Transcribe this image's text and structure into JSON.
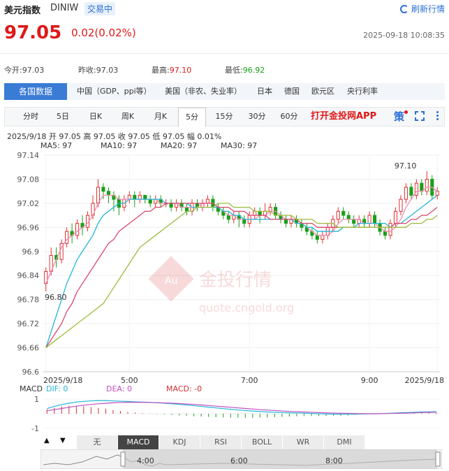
{
  "header": {
    "name": "美元指数",
    "code": "DINIW",
    "market_tag": "交易中",
    "refresh_label": "刷新行情",
    "price": "97.05",
    "change": "0.02(0.02%)",
    "datetime": "2025-09-18 10:08:35"
  },
  "stats": [
    {
      "label": "今开:",
      "value": "97.03",
      "tone": "normal"
    },
    {
      "label": "昨收:",
      "value": "97.03",
      "tone": "normal"
    },
    {
      "label": "最高:",
      "value": "97.10",
      "tone": "red"
    },
    {
      "label": "最低:",
      "value": "96.92",
      "tone": "green"
    }
  ],
  "regions": {
    "active": "各国数据",
    "items": [
      "中国（GDP、ppi等）",
      "美国（非农、失业率）",
      "日本",
      "德国",
      "欧元区",
      "央行利率"
    ]
  },
  "periods": {
    "items": [
      "分时",
      "5日",
      "日K",
      "周K",
      "月K",
      "5分",
      "15分",
      "30分",
      "60分"
    ],
    "active_index": 5,
    "promo": "打开金投网APP",
    "strategy_label": "策"
  },
  "ohlc_line": "2025/9/18  开 97.05  高 97.05  收 97.05  低 97.05  幅 0.01%",
  "ma_legend": [
    {
      "label": "MA5: 97",
      "color": "#f08cb4"
    },
    {
      "label": "MA10: 97",
      "color": "#22b5d8"
    },
    {
      "label": "MA20: 97",
      "color": "#d9466c"
    },
    {
      "label": "MA30: 97",
      "color": "#9cbc3c"
    }
  ],
  "watermark": {
    "brand": "金投行情",
    "site": "quote.cngold.org",
    "badge": "Au"
  },
  "chart_data": {
    "type": "candlestick",
    "title": "",
    "y_ticks": [
      "97.14",
      "97.08",
      "97.02",
      "96.96",
      "96.9",
      "96.84",
      "96.78",
      "96.72",
      "96.66",
      "96.6"
    ],
    "ylim": [
      96.6,
      97.14
    ],
    "x_labels": [
      "2025/9/18",
      "5:00",
      "7:00",
      "9:00",
      "2025/9/18"
    ],
    "high_label": "97.10",
    "low_label": "96.80",
    "candles": [
      [
        96.82,
        96.85,
        96.8,
        96.86
      ],
      [
        96.85,
        96.89,
        96.84,
        96.91
      ],
      [
        96.89,
        96.88,
        96.86,
        96.91
      ],
      [
        96.88,
        96.92,
        96.87,
        96.93
      ],
      [
        96.92,
        96.95,
        96.91,
        96.96
      ],
      [
        96.95,
        96.94,
        96.92,
        96.97
      ],
      [
        96.94,
        96.97,
        96.93,
        96.98
      ],
      [
        96.97,
        96.96,
        96.94,
        96.99
      ],
      [
        96.96,
        96.99,
        96.95,
        97.0
      ],
      [
        96.99,
        97.02,
        96.98,
        97.04
      ],
      [
        97.02,
        97.06,
        97.01,
        97.08
      ],
      [
        97.06,
        97.05,
        97.03,
        97.07
      ],
      [
        97.05,
        97.04,
        97.02,
        97.06
      ],
      [
        97.04,
        97.03,
        97.0,
        97.05
      ],
      [
        97.03,
        97.01,
        96.99,
        97.04
      ],
      [
        97.01,
        97.03,
        97.0,
        97.04
      ],
      [
        97.03,
        97.04,
        97.02,
        97.05
      ],
      [
        97.04,
        97.03,
        97.01,
        97.05
      ],
      [
        97.03,
        97.04,
        97.02,
        97.05
      ],
      [
        97.04,
        97.03,
        97.02,
        97.04
      ],
      [
        97.03,
        97.02,
        97.01,
        97.04
      ],
      [
        97.02,
        97.03,
        97.01,
        97.04
      ],
      [
        97.03,
        97.02,
        97.01,
        97.04
      ],
      [
        97.02,
        97.02,
        97.01,
        97.03
      ],
      [
        97.02,
        97.01,
        97.0,
        97.03
      ],
      [
        97.01,
        97.02,
        97.0,
        97.03
      ],
      [
        97.02,
        97.01,
        97.0,
        97.03
      ],
      [
        97.01,
        97.0,
        96.99,
        97.02
      ],
      [
        97.0,
        97.02,
        96.99,
        97.03
      ],
      [
        97.02,
        97.01,
        97.0,
        97.03
      ],
      [
        97.01,
        97.02,
        97.0,
        97.03
      ],
      [
        97.02,
        97.03,
        97.01,
        97.04
      ],
      [
        97.03,
        97.01,
        97.0,
        97.04
      ],
      [
        97.01,
        97.0,
        96.99,
        97.02
      ],
      [
        97.0,
        96.99,
        96.98,
        97.01
      ],
      [
        96.99,
        96.98,
        96.97,
        97.0
      ],
      [
        96.98,
        96.99,
        96.97,
        97.0
      ],
      [
        96.99,
        96.98,
        96.96,
        97.0
      ],
      [
        96.98,
        96.97,
        96.96,
        96.99
      ],
      [
        96.97,
        96.99,
        96.96,
        97.0
      ],
      [
        96.99,
        97.0,
        96.98,
        97.01
      ],
      [
        97.0,
        96.99,
        96.97,
        97.01
      ],
      [
        96.99,
        97.0,
        96.98,
        97.02
      ],
      [
        97.0,
        97.01,
        96.99,
        97.02
      ],
      [
        97.01,
        96.99,
        96.98,
        97.02
      ],
      [
        96.99,
        96.98,
        96.97,
        97.0
      ],
      [
        96.98,
        96.97,
        96.96,
        96.99
      ],
      [
        96.97,
        96.98,
        96.96,
        96.99
      ],
      [
        96.98,
        96.97,
        96.96,
        96.99
      ],
      [
        96.97,
        96.96,
        96.95,
        96.98
      ],
      [
        96.96,
        96.95,
        96.94,
        96.97
      ],
      [
        96.95,
        96.94,
        96.93,
        96.96
      ],
      [
        96.94,
        96.93,
        96.92,
        96.95
      ],
      [
        96.93,
        96.94,
        96.92,
        96.95
      ],
      [
        96.94,
        96.96,
        96.93,
        96.97
      ],
      [
        96.96,
        96.98,
        96.95,
        96.99
      ],
      [
        96.98,
        97.0,
        96.97,
        97.01
      ],
      [
        97.0,
        96.99,
        96.98,
        97.01
      ],
      [
        96.99,
        96.98,
        96.97,
        97.0
      ],
      [
        96.98,
        96.97,
        96.96,
        96.99
      ],
      [
        96.97,
        96.98,
        96.96,
        96.99
      ],
      [
        96.98,
        96.97,
        96.96,
        96.99
      ],
      [
        96.97,
        96.99,
        96.96,
        97.0
      ],
      [
        96.99,
        96.97,
        96.96,
        97.0
      ],
      [
        96.97,
        96.95,
        96.94,
        96.98
      ],
      [
        96.95,
        96.94,
        96.93,
        96.96
      ],
      [
        96.94,
        96.97,
        96.93,
        96.98
      ],
      [
        96.97,
        97.0,
        96.96,
        97.01
      ],
      [
        97.0,
        97.03,
        96.99,
        97.04
      ],
      [
        97.03,
        97.06,
        97.02,
        97.07
      ],
      [
        97.06,
        97.04,
        97.03,
        97.07
      ],
      [
        97.04,
        97.07,
        97.03,
        97.08
      ],
      [
        97.07,
        97.05,
        97.04,
        97.08
      ],
      [
        97.05,
        97.08,
        97.04,
        97.1
      ],
      [
        97.08,
        97.04,
        97.03,
        97.09
      ],
      [
        97.04,
        97.05,
        97.03,
        97.06
      ]
    ],
    "series": [
      {
        "name": "MA5",
        "values": [
          96.82,
          96.85,
          96.88,
          96.91,
          96.93,
          96.94,
          96.95,
          96.96,
          96.97,
          96.99,
          97.02,
          97.04,
          97.04,
          97.04,
          97.03,
          97.03,
          97.03,
          97.03,
          97.03,
          97.03,
          97.03,
          97.03,
          97.02,
          97.02,
          97.02,
          97.02,
          97.01,
          97.01,
          97.01,
          97.01,
          97.02,
          97.02,
          97.02,
          97.01,
          97.0,
          96.99,
          96.99,
          96.98,
          96.98,
          96.98,
          96.98,
          96.99,
          96.99,
          97.0,
          97.0,
          96.99,
          96.98,
          96.98,
          96.97,
          96.97,
          96.96,
          96.95,
          96.94,
          96.94,
          96.94,
          96.95,
          96.97,
          96.98,
          96.98,
          96.98,
          96.98,
          96.97,
          96.97,
          96.97,
          96.96,
          96.95,
          96.95,
          96.96,
          96.98,
          97.01,
          97.03,
          97.05,
          97.05,
          97.06,
          97.06,
          97.05
        ]
      },
      {
        "name": "MA10",
        "values": [
          96.66,
          96.7,
          96.74,
          96.78,
          96.82,
          96.85,
          96.88,
          96.9,
          96.92,
          96.94,
          96.97,
          96.99,
          97.0,
          97.01,
          97.02,
          97.02,
          97.03,
          97.03,
          97.03,
          97.03,
          97.03,
          97.03,
          97.03,
          97.02,
          97.02,
          97.02,
          97.02,
          97.02,
          97.01,
          97.01,
          97.01,
          97.01,
          97.01,
          97.01,
          97.0,
          97.0,
          96.99,
          96.99,
          96.98,
          96.98,
          96.98,
          96.98,
          96.98,
          96.98,
          96.98,
          96.98,
          96.98,
          96.98,
          96.97,
          96.97,
          96.96,
          96.96,
          96.95,
          96.95,
          96.95,
          96.95,
          96.95,
          96.96,
          96.96,
          96.96,
          96.97,
          96.97,
          96.97,
          96.97,
          96.97,
          96.97,
          96.96,
          96.97,
          96.97,
          96.98,
          96.99,
          97.0,
          97.01,
          97.02,
          97.03,
          97.04
        ]
      },
      {
        "name": "MA20",
        "values": [
          96.66,
          96.68,
          96.7,
          96.72,
          96.75,
          96.77,
          96.8,
          96.82,
          96.84,
          96.86,
          96.88,
          96.9,
          96.92,
          96.93,
          96.95,
          96.96,
          96.97,
          96.98,
          96.99,
          97.0,
          97.0,
          97.01,
          97.01,
          97.02,
          97.02,
          97.02,
          97.02,
          97.02,
          97.02,
          97.02,
          97.02,
          97.02,
          97.02,
          97.01,
          97.01,
          97.01,
          97.0,
          97.0,
          97.0,
          96.99,
          96.99,
          96.99,
          96.99,
          96.98,
          96.98,
          96.98,
          96.98,
          96.98,
          96.98,
          96.97,
          96.97,
          96.97,
          96.96,
          96.96,
          96.96,
          96.96,
          96.96,
          96.96,
          96.96,
          96.96,
          96.96,
          96.96,
          96.96,
          96.96,
          96.96,
          96.96,
          96.96,
          96.97,
          96.97,
          96.97,
          96.98,
          96.98,
          96.99,
          96.99,
          97.0,
          97.01
        ]
      },
      {
        "name": "MA30",
        "values": [
          96.66,
          96.67,
          96.68,
          96.69,
          96.7,
          96.71,
          96.72,
          96.73,
          96.74,
          96.75,
          96.76,
          96.77,
          96.79,
          96.81,
          96.83,
          96.85,
          96.87,
          96.89,
          96.91,
          96.92,
          96.93,
          96.94,
          96.95,
          96.96,
          96.97,
          96.98,
          96.99,
          97.0,
          97.0,
          97.01,
          97.01,
          97.01,
          97.01,
          97.02,
          97.02,
          97.02,
          97.01,
          97.01,
          97.01,
          97.01,
          97.0,
          97.0,
          97.0,
          97.0,
          96.99,
          96.99,
          96.99,
          96.99,
          96.98,
          96.98,
          96.98,
          96.98,
          96.97,
          96.97,
          96.97,
          96.97,
          96.96,
          96.96,
          96.96,
          96.96,
          96.96,
          96.96,
          96.96,
          96.96,
          96.96,
          96.96,
          96.96,
          96.96,
          96.96,
          96.96,
          96.97,
          96.97,
          96.97,
          96.98,
          96.98,
          96.99
        ]
      }
    ]
  },
  "macd": {
    "label": "MACD",
    "dif_label": "DIF: 0",
    "dea_label": "DEA: 0",
    "macd_label": "MACD: -0",
    "dif_color": "#22b5d8",
    "dea_color": "#c04fc0",
    "macd_color": "#d03030",
    "y_ticks": [
      "1",
      "-1"
    ],
    "ylim": [
      -1.2,
      1.2
    ],
    "dif": [
      0.35,
      0.5,
      0.62,
      0.72,
      0.8,
      0.85,
      0.88,
      0.9,
      0.9,
      0.88,
      0.86,
      0.84,
      0.82,
      0.8,
      0.78,
      0.75,
      0.72,
      0.68,
      0.64,
      0.6,
      0.55,
      0.5,
      0.45,
      0.4,
      0.35,
      0.3,
      0.26,
      0.22,
      0.18,
      0.15,
      0.12,
      0.1,
      0.08,
      0.06,
      0.05,
      0.04,
      0.02,
      0.0,
      -0.02,
      -0.03,
      -0.04,
      -0.04,
      -0.03,
      -0.02,
      -0.01,
      0.0,
      0.02,
      0.04,
      0.06,
      0.08,
      0.1,
      0.12,
      0.13,
      0.14
    ],
    "dea": [
      0.2,
      0.28,
      0.36,
      0.44,
      0.52,
      0.58,
      0.64,
      0.68,
      0.72,
      0.75,
      0.77,
      0.78,
      0.78,
      0.78,
      0.77,
      0.76,
      0.74,
      0.72,
      0.7,
      0.67,
      0.64,
      0.6,
      0.56,
      0.52,
      0.48,
      0.44,
      0.4,
      0.36,
      0.32,
      0.28,
      0.25,
      0.22,
      0.19,
      0.16,
      0.14,
      0.12,
      0.1,
      0.08,
      0.06,
      0.04,
      0.03,
      0.02,
      0.01,
      0.0,
      0.0,
      0.0,
      0.01,
      0.02,
      0.03,
      0.04,
      0.06,
      0.08,
      0.09,
      0.1
    ],
    "hist": [
      0.3,
      0.4,
      0.5,
      0.55,
      0.55,
      0.5,
      0.45,
      0.4,
      0.35,
      0.25,
      0.18,
      0.12,
      0.08,
      0.04,
      0.02,
      -0.02,
      -0.04,
      -0.08,
      -0.12,
      -0.14,
      -0.18,
      -0.2,
      -0.22,
      -0.24,
      -0.26,
      -0.28,
      -0.28,
      -0.28,
      -0.28,
      -0.26,
      -0.26,
      -0.24,
      -0.22,
      -0.2,
      -0.18,
      -0.16,
      -0.16,
      -0.16,
      -0.16,
      -0.14,
      -0.14,
      -0.12,
      -0.08,
      -0.04,
      -0.02,
      0.0,
      0.02,
      0.04,
      0.06,
      0.08,
      0.08,
      0.08,
      0.08,
      0.08
    ]
  },
  "indicator_tabs": {
    "items": [
      "无",
      "MACD",
      "KDJ",
      "RSI",
      "BOLL",
      "WR",
      "DMI"
    ],
    "active_index": 1,
    "up_arrow": "▲",
    "down_arrow": "▼"
  },
  "navigator": {
    "labels": [
      "4:00",
      "6:00",
      "8:00"
    ]
  }
}
